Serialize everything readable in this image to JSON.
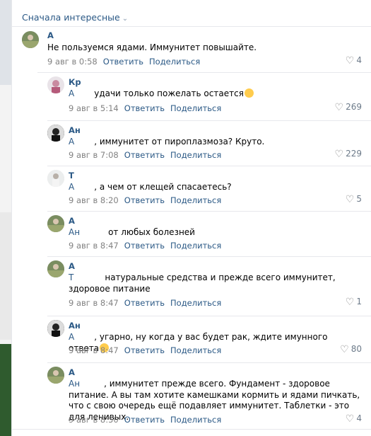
{
  "sort_label": "Сначала интересные",
  "comments": [
    {
      "name": "А",
      "reply_to": "",
      "text": "Не пользуемся ядами. Иммунитет повышайте.",
      "date": "9 авг в 0:58",
      "reply": "Ответить",
      "share": "Поделиться",
      "likes": "4"
    },
    {
      "name": "Кр",
      "reply_to": "А",
      "text": "удачи только пожелать остается",
      "date": "9 авг в 5:14",
      "reply": "Ответить",
      "share": "Поделиться",
      "likes": "269",
      "emoji": "rofl-emoji"
    },
    {
      "name": "Ан",
      "reply_to": "А",
      "text": ", иммунитет от пироплазмоза? Круто.",
      "date": "9 авг в 7:08",
      "reply": "Ответить",
      "share": "Поделиться",
      "likes": "229"
    },
    {
      "name": "Т",
      "reply_to": "А",
      "text": ", а чем от клещей спасаетесь?",
      "date": "9 авг в 8:20",
      "reply": "Ответить",
      "share": "Поделиться",
      "likes": "5"
    },
    {
      "name": "А",
      "reply_to": "Ан",
      "text": "от любых болезней",
      "date": "9 авг в 8:47",
      "reply": "Ответить",
      "share": "Поделиться",
      "likes": ""
    },
    {
      "name": "А",
      "reply_to": "Т",
      "text": "натуральные средства и прежде всего иммунитет, здоровое питание",
      "date": "9 авг в 8:47",
      "reply": "Ответить",
      "share": "Поделиться",
      "likes": "1"
    },
    {
      "name": "Ан",
      "reply_to": "А",
      "text": ", угарно, ну когда у вас будет рак, ждите имунного ответа",
      "date": "9 авг в 8:47",
      "reply": "Ответить",
      "share": "Поделиться",
      "likes": "80",
      "emoji": "smirk-emoji"
    },
    {
      "name": "А",
      "reply_to": "Ан",
      "text": ", иммунитет прежде всего. Фундамент - здоровое питание. А вы там хотите камешками кормить и ядами пичкать, что с свою очередь ещё подавляет иммунитет. Таблетки - это для ленивых.",
      "date": "9 авг в 8:50",
      "reply": "Ответить",
      "share": "Поделиться",
      "likes": "4"
    }
  ],
  "colors": {
    "link": "#2a5885",
    "meta": "#828282",
    "separator": "#e7e8ec"
  }
}
